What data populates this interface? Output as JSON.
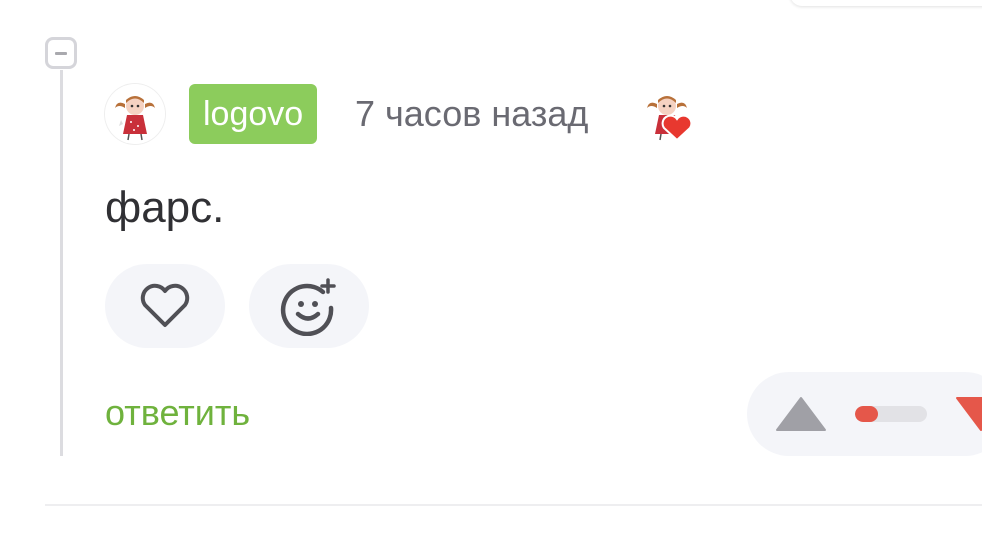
{
  "comment": {
    "username": "logovo",
    "time": "7 часов назад",
    "text": "фарс.",
    "reply_label": "ответить",
    "avatar_icon": "girl-with-pigtails-avatar",
    "reaction_icon": "heart-reaction-avatar"
  },
  "actions": {
    "like_icon": "heart-outline-icon",
    "add_reaction_icon": "smiley-plus-icon"
  },
  "rating": {
    "up_icon": "triangle-up-icon",
    "down_icon": "triangle-down-icon",
    "negative_share": 0.32
  },
  "colors": {
    "username_badge": "#8ccc5c",
    "reply_link": "#6fb23d",
    "vote_negative": "#e5574a",
    "vote_up_icon": "#a0a0a6"
  }
}
